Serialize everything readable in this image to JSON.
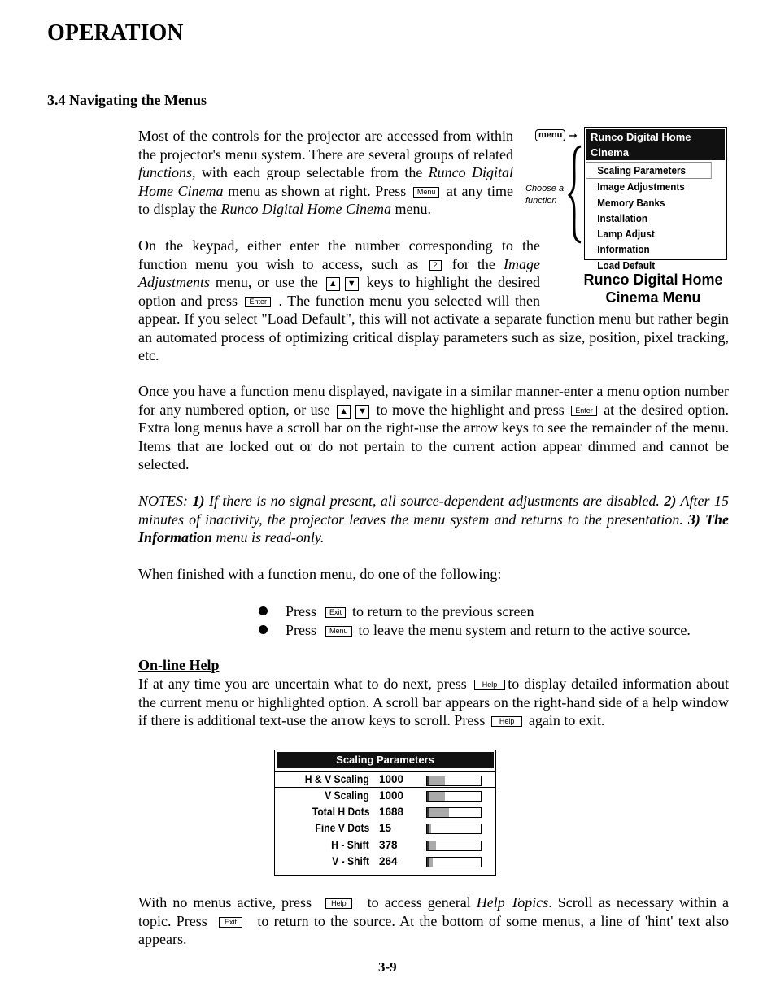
{
  "header": {
    "title": "OPERATION",
    "section": "3.4 Navigating the Menus"
  },
  "p1": {
    "s0": "Most of the controls for the projector are accessed from within the projector's menu system. There are several groups of related ",
    "i0": "functions",
    "s1": ", with each group selectable from the ",
    "i1": "Runco Digital Home Cinema",
    "s2": " menu as shown at right. Press ",
    "k0": "Menu",
    "s3": " at any time to display the ",
    "i2": "Runco Digital Home Cinema",
    "s4": " menu."
  },
  "p2": {
    "s0": "On the keypad, either enter the number corresponding to the function menu you wish to access, such as ",
    "k0": "2",
    "s1": " for the ",
    "i0": "Image Adjustments",
    "s2": " menu, or use the ",
    "up": "▲",
    "down": "▼",
    "s3": " keys to highlight the desired option and press ",
    "k1": "Enter",
    "s4": " . The function menu you selected will then appear. If you select \"Load Default\", this will not activate a separate function menu but rather begin an automated process of optimizing critical display parameters such as size, position, pixel tracking, etc."
  },
  "p3": {
    "s0": "Once you have a function menu displayed, navigate in a similar manner-enter a menu option number for any numbered option, or use ",
    "up": "▲",
    "down": "▼",
    "s1": " to move the highlight and press ",
    "k0": "Enter",
    "s2": " at the desired option. Extra long menus have a scroll bar on the right-use the arrow keys to see the remainder of the menu. Items that are locked out or do not pertain to the current action appear dimmed and cannot be selected."
  },
  "notes": {
    "s0": "NOTES: ",
    "b0": "1)",
    "s1": " If there is no signal present, all source-dependent adjustments are disabled. ",
    "b1": "2)",
    "s2": " After 15 minutes of inactivity, the projector leaves the menu system and returns to the presentation. ",
    "b2": "3) The Information",
    "s3": " menu is read-only."
  },
  "p4": "When finished with a function menu, do one of the following:",
  "bullets": [
    {
      "press": "Press",
      "key": "Exit",
      "text": "to return to the previous screen"
    },
    {
      "press": "Press",
      "key": "Menu",
      "text": "to leave the menu system and return to the active source."
    }
  ],
  "help": {
    "heading": "On-line Help",
    "s0": "If at any time you are uncertain what to do next, press ",
    "k0": "Help",
    "s1": "to display detailed information about the current menu or highlighted option. A scroll bar appears on the right-hand side of a help window if there is additional text-use the arrow keys to scroll. Press ",
    "k1": "Help",
    "s2": " again to exit."
  },
  "p6": {
    "s0": "With no menus active, press ",
    "k0": "Help",
    "s1": " to access general ",
    "i0": "Help Topics",
    "s2": ". Scroll as necessary within a topic. Press ",
    "k1": "Exit",
    "s3": " to return to the source. At the bottom of some menus, a line of 'hint' text also appears."
  },
  "menu_diagram": {
    "menu_key": "menu",
    "choose": "Choose a",
    "function": "function",
    "title": "Runco Digital Home Cinema",
    "items": [
      "Scaling Parameters",
      "Image Adjustments",
      "Memory Banks",
      "Installation",
      "Lamp Adjust",
      "Information",
      "Load Default"
    ],
    "selected": "Scaling Parameters",
    "caption1": "Runco Digital Home",
    "caption2": "Cinema Menu"
  },
  "scaling": {
    "title": "Scaling Parameters",
    "rows": [
      {
        "label": "H & V Scaling",
        "value": "1000",
        "fill": 0.3
      },
      {
        "label": "V Scaling",
        "value": "1000",
        "fill": 0.3
      },
      {
        "label": "Total H Dots",
        "value": "1688",
        "fill": 0.38
      },
      {
        "label": "Fine V Dots",
        "value": "15",
        "fill": 0.05
      },
      {
        "label": "H - Shift",
        "value": "378",
        "fill": 0.13
      },
      {
        "label": "V - Shift",
        "value": "264",
        "fill": 0.08
      }
    ]
  },
  "footer": {
    "page": "3-9"
  }
}
